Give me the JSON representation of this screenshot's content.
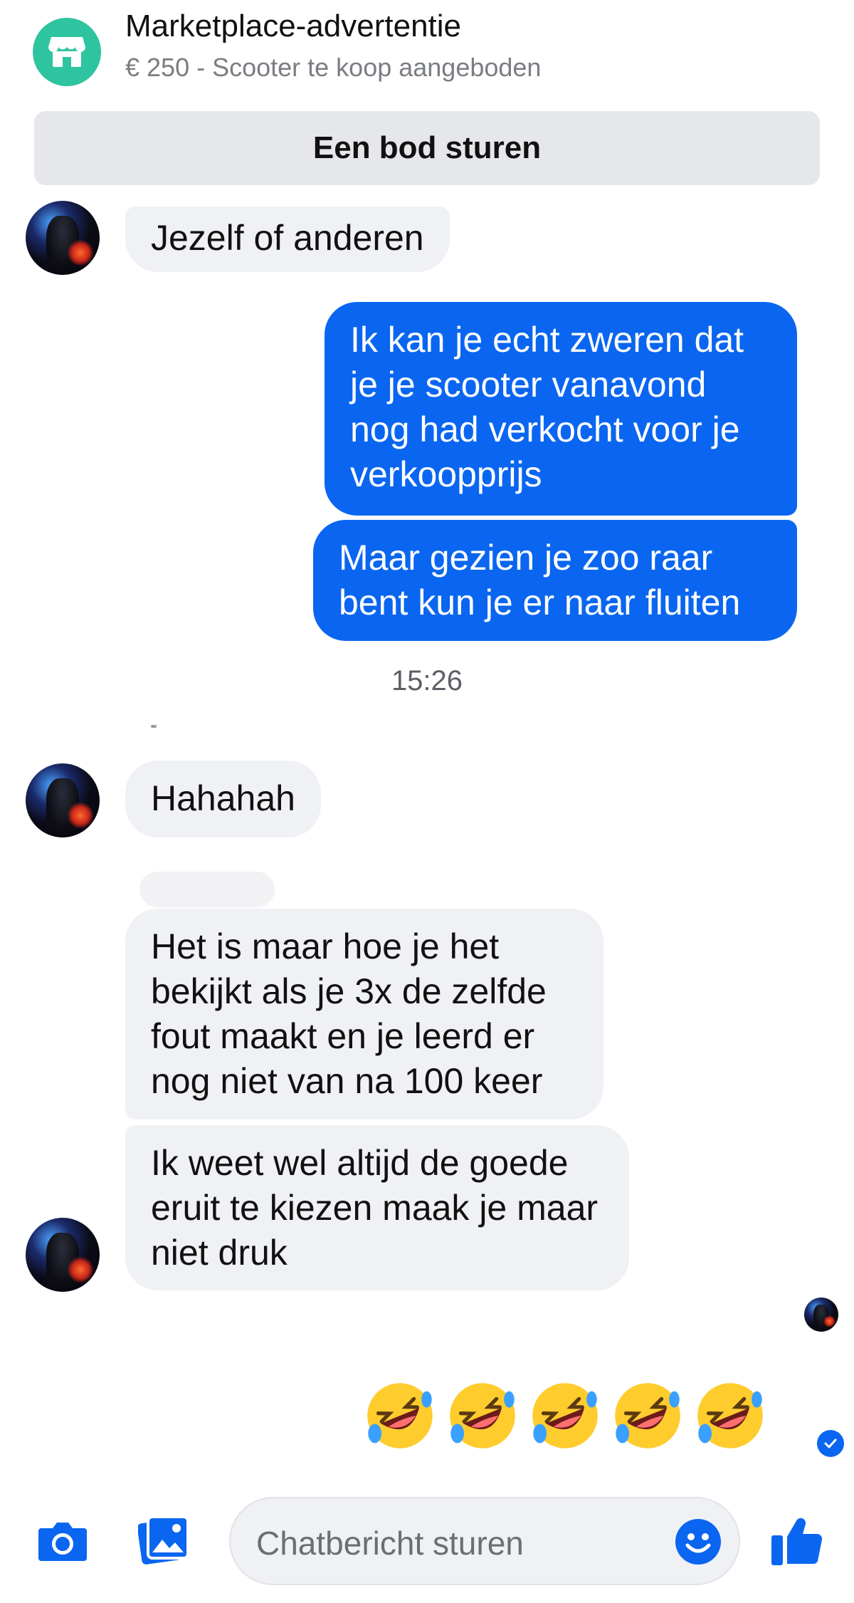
{
  "header": {
    "title": "Marketplace-advertentie",
    "subtitle": "€ 250 - Scooter te koop aangeboden",
    "icon": "store-icon",
    "accent": "#2fc4a0"
  },
  "offer_button": {
    "label": "Een bod sturen"
  },
  "messages": {
    "m1": "Jezelf of anderen",
    "m2": "Ik kan je echt zweren dat je je scooter vanavond nog had verkocht voor je verkoopprijs",
    "m3": "Maar gezien je zoo raar bent kun je er naar fluiten",
    "time": "15:26",
    "m4": "Hahahah",
    "m5": "Het is maar hoe je het bekijkt als je 3x de zelfde fout maakt en je leerd er nog niet van na 100 keer",
    "m6": "Ik weet wel altijd de goede eruit te kiezen maak je maar niet druk",
    "reaction": "🤣🤣🤣🤣🤣"
  },
  "composer": {
    "placeholder": "Chatbericht sturen",
    "icons": [
      "camera-icon",
      "gallery-icon",
      "emoji-icon",
      "thumbs-up-icon"
    ],
    "accent": "#0a66f0"
  },
  "colors": {
    "outgoing": "#0a66f0",
    "incoming": "#f0f1f4"
  }
}
